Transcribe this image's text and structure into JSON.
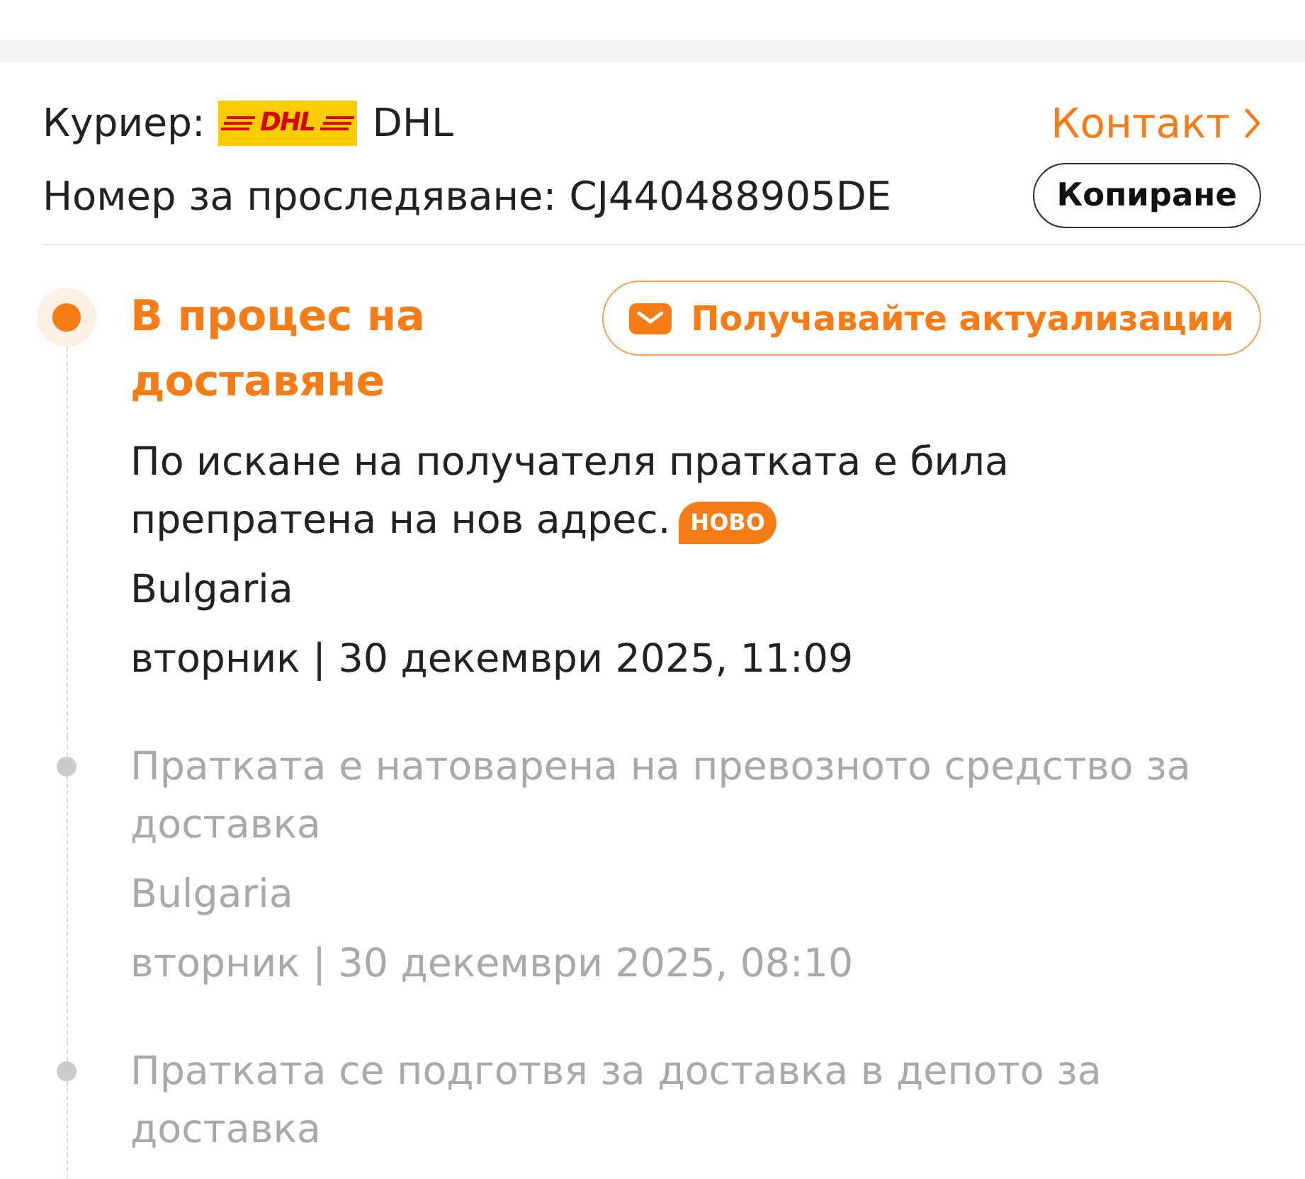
{
  "courier": {
    "label": "Куриер:",
    "logo_text": "DHL",
    "name": "DHL",
    "contact_link": "Контакт"
  },
  "tracking": {
    "label": "Номер за проследяване:",
    "number": "CJ440488905DE",
    "copy_button": "Копиране"
  },
  "timeline": {
    "subscribe_button": "Получавайте актуализации",
    "events": [
      {
        "active": true,
        "status": "В процес на доставяне",
        "description": "По искане на получателя пратката е била препратена на нов адрес.",
        "badge": "НОВО",
        "location": "Bulgaria",
        "time": "вторник | 30 декември 2025, 11:09"
      },
      {
        "active": false,
        "description": "Пратката е натоварена на превозното средство за доставка",
        "location": "Bulgaria",
        "time": "вторник | 30 декември 2025, 08:10"
      },
      {
        "active": false,
        "description": "Пратката се подготвя за доставка в депото за доставка"
      }
    ]
  }
}
